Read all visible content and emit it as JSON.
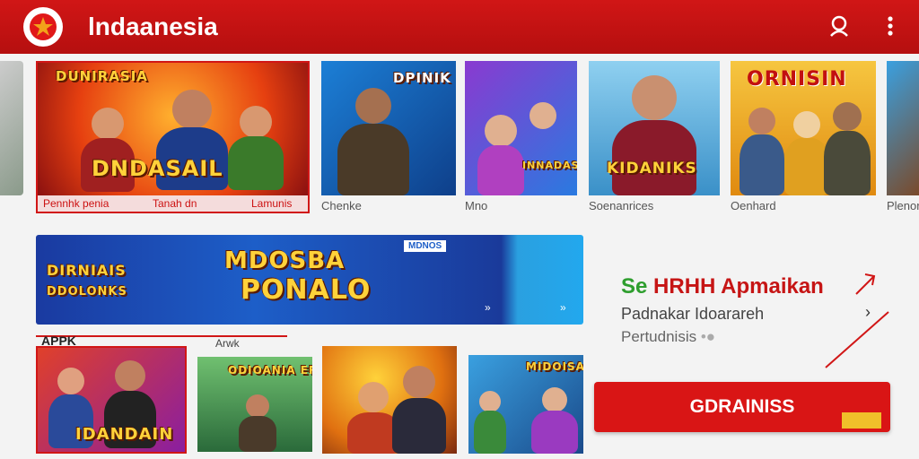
{
  "header": {
    "title": "lndaanesia"
  },
  "row1": {
    "featured": {
      "art_title": "DNDASAIL",
      "art_top": "DUNIRASIA",
      "caption": "Pennhk penia",
      "caption2": "Tanah dn",
      "caption3": "Lamunis"
    },
    "items": [
      {
        "caption": "Chenke",
        "art_text": "DPINIK PIABA"
      },
      {
        "caption": "Mno",
        "art_text": "INNADAS"
      },
      {
        "caption": "Soenanrices",
        "art_text": "KIDANIKS"
      },
      {
        "caption": "Oenhard",
        "art_text": "ORNISIN"
      },
      {
        "caption": "Plenor"
      }
    ]
  },
  "banner": {
    "art_title": "MDOSBA",
    "art_title2": "PONALO",
    "left_text": "DIRNIAIS",
    "left_text2": "DDOLONKS",
    "badge": "MDNOS"
  },
  "promo": {
    "title_prefix": "Se",
    "title": "HRHH Apmaikan",
    "line1": "Padnakar Idoarareh",
    "line2": "Pertudnisis"
  },
  "cta": {
    "label": "GDRAINISS"
  },
  "row3": {
    "section_label": "APPK",
    "section_label2": "Arwk",
    "items": [
      {
        "art_text": "IDANDAIN"
      },
      {
        "art_text": "ODIOANIA ERORUS"
      },
      {
        "art_text": ""
      },
      {
        "art_text": "MIDOISAS"
      }
    ]
  },
  "colors": {
    "primary": "#d11616",
    "accent_green": "#2e9e2e"
  }
}
